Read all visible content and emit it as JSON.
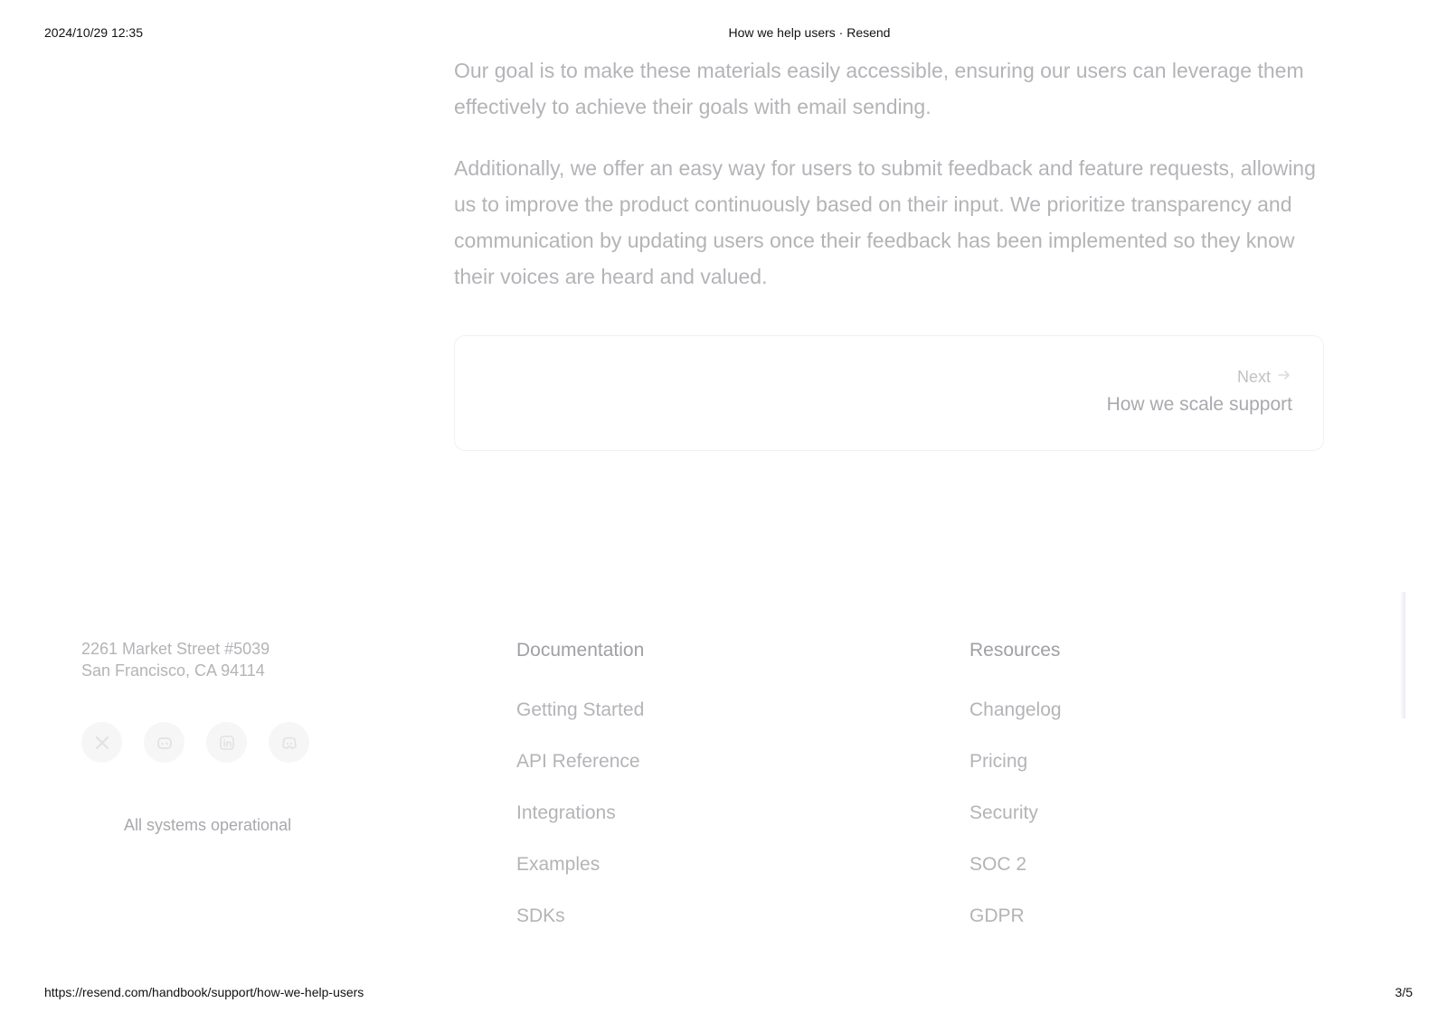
{
  "print_header": {
    "datetime": "2024/10/29 12:35",
    "title": "How we help users · Resend"
  },
  "article": {
    "paragraphs": [
      "Our goal is to make these materials easily accessible, ensuring our users can leverage them effectively to achieve their goals with email sending.",
      "Additionally, we offer an easy way for users to submit feedback and feature requests, allowing us to improve the product continuously based on their input. We prioritize transparency and communication by updating users once their feedback has been implemented so they know their voices are heard and valued."
    ]
  },
  "pagination": {
    "next_label": "Next",
    "next_title": "How we scale support"
  },
  "footer": {
    "address_line1": "2261 Market Street #5039",
    "address_line2": "San Francisco, CA 94114",
    "socials": [
      "x-icon",
      "github-icon",
      "linkedin-icon",
      "discord-icon"
    ],
    "status": "All systems operational",
    "documentation": {
      "heading": "Documentation",
      "links": [
        "Getting Started",
        "API Reference",
        "Integrations",
        "Examples",
        "SDKs"
      ]
    },
    "resources": {
      "heading": "Resources",
      "links": [
        "Changelog",
        "Pricing",
        "Security",
        "SOC 2",
        "GDPR"
      ]
    }
  },
  "print_footer": {
    "url": "https://resend.com/handbook/support/how-we-help-users",
    "page": "3/5"
  }
}
